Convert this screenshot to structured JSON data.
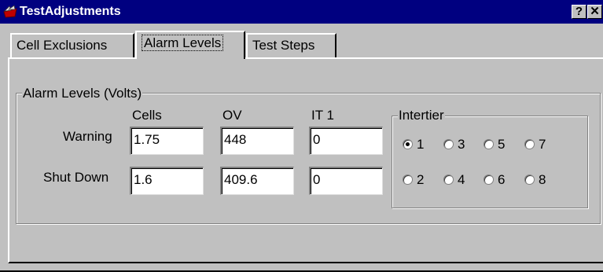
{
  "window": {
    "title": "TestAdjustments",
    "help_label": "?",
    "close_label": "✕"
  },
  "tabs": [
    "Cell Exclusions",
    "Alarm Levels",
    "Test Steps"
  ],
  "alarm_group": {
    "label": "Alarm Levels (Volts)",
    "columns": [
      "Cells",
      "OV",
      "IT 1"
    ],
    "rows": [
      {
        "label": "Warning",
        "values": [
          "1.75",
          "448",
          "0"
        ]
      },
      {
        "label": "Shut Down",
        "values": [
          "1.6",
          "409.6",
          "0"
        ]
      }
    ]
  },
  "intertier": {
    "label": "Intertier",
    "options": [
      "1",
      "3",
      "5",
      "7",
      "2",
      "4",
      "6",
      "8"
    ],
    "selected": "1"
  },
  "icons": {
    "app": "app-icon",
    "help": "help-icon",
    "close": "close-icon"
  }
}
